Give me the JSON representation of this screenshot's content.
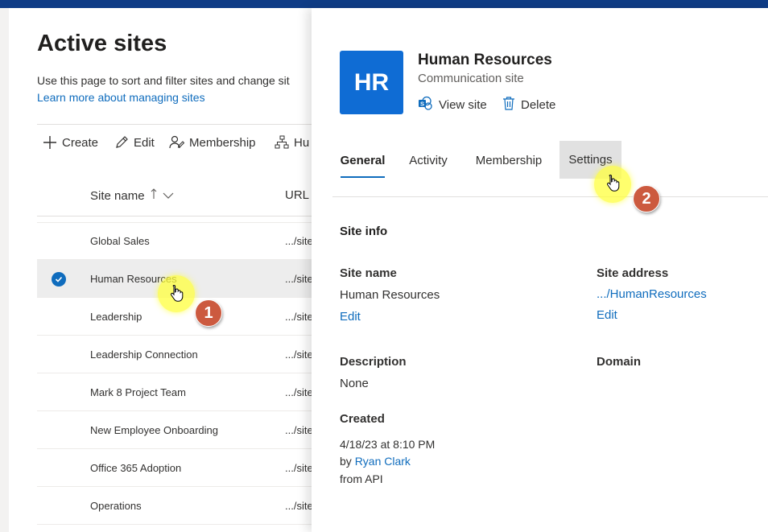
{
  "background_page": {
    "title": "Active sites",
    "description": "Use this page to sort and filter sites and change sit",
    "learn_more": "Learn more about managing sites",
    "commands": [
      {
        "label": "Create",
        "icon": "plus-icon"
      },
      {
        "label": "Edit",
        "icon": "pencil-icon"
      },
      {
        "label": "Membership",
        "icon": "people-icon"
      },
      {
        "label": "Hu",
        "icon": "hub-icon"
      }
    ],
    "columns": {
      "site_name": "Site name",
      "url": "URL"
    },
    "rows": [
      {
        "name": "Global Sales",
        "url": ".../site"
      },
      {
        "name": "Human Resources",
        "url": ".../site",
        "selected": true
      },
      {
        "name": "Leadership",
        "url": ".../site"
      },
      {
        "name": "Leadership Connection",
        "url": ".../site"
      },
      {
        "name": "Mark 8 Project Team",
        "url": ".../site"
      },
      {
        "name": "New Employee Onboarding",
        "url": ".../site"
      },
      {
        "name": "Office 365 Adoption",
        "url": ".../site"
      },
      {
        "name": "Operations",
        "url": ".../site"
      }
    ]
  },
  "panel": {
    "logo_text": "HR",
    "site_title": "Human Resources",
    "site_type": "Communication site",
    "actions": {
      "view_site": "View site",
      "delete": "Delete"
    },
    "tabs": [
      {
        "label": "General",
        "active": true
      },
      {
        "label": "Activity"
      },
      {
        "label": "Membership"
      },
      {
        "label": "Settings",
        "hover": true
      }
    ],
    "site_info": {
      "heading": "Site info",
      "site_name_label": "Site name",
      "site_name_value": "Human Resources",
      "site_name_edit": "Edit",
      "site_address_label": "Site address",
      "site_address_value": ".../HumanResources",
      "site_address_edit": "Edit",
      "description_label": "Description",
      "description_value": "None",
      "domain_label": "Domain",
      "created_label": "Created",
      "created_date": "4/18/23 at 8:10 PM",
      "created_by_prefix": "by",
      "created_by": "Ryan Clark",
      "created_from": "from API"
    }
  },
  "annotations": {
    "step1": "1",
    "step2": "2"
  },
  "colors": {
    "accent": "#0f6cbd",
    "logo": "#0f6cd4",
    "topbar": "#0f3c86",
    "marker": "#cc5a3f",
    "highlight": "#ffff3c"
  }
}
